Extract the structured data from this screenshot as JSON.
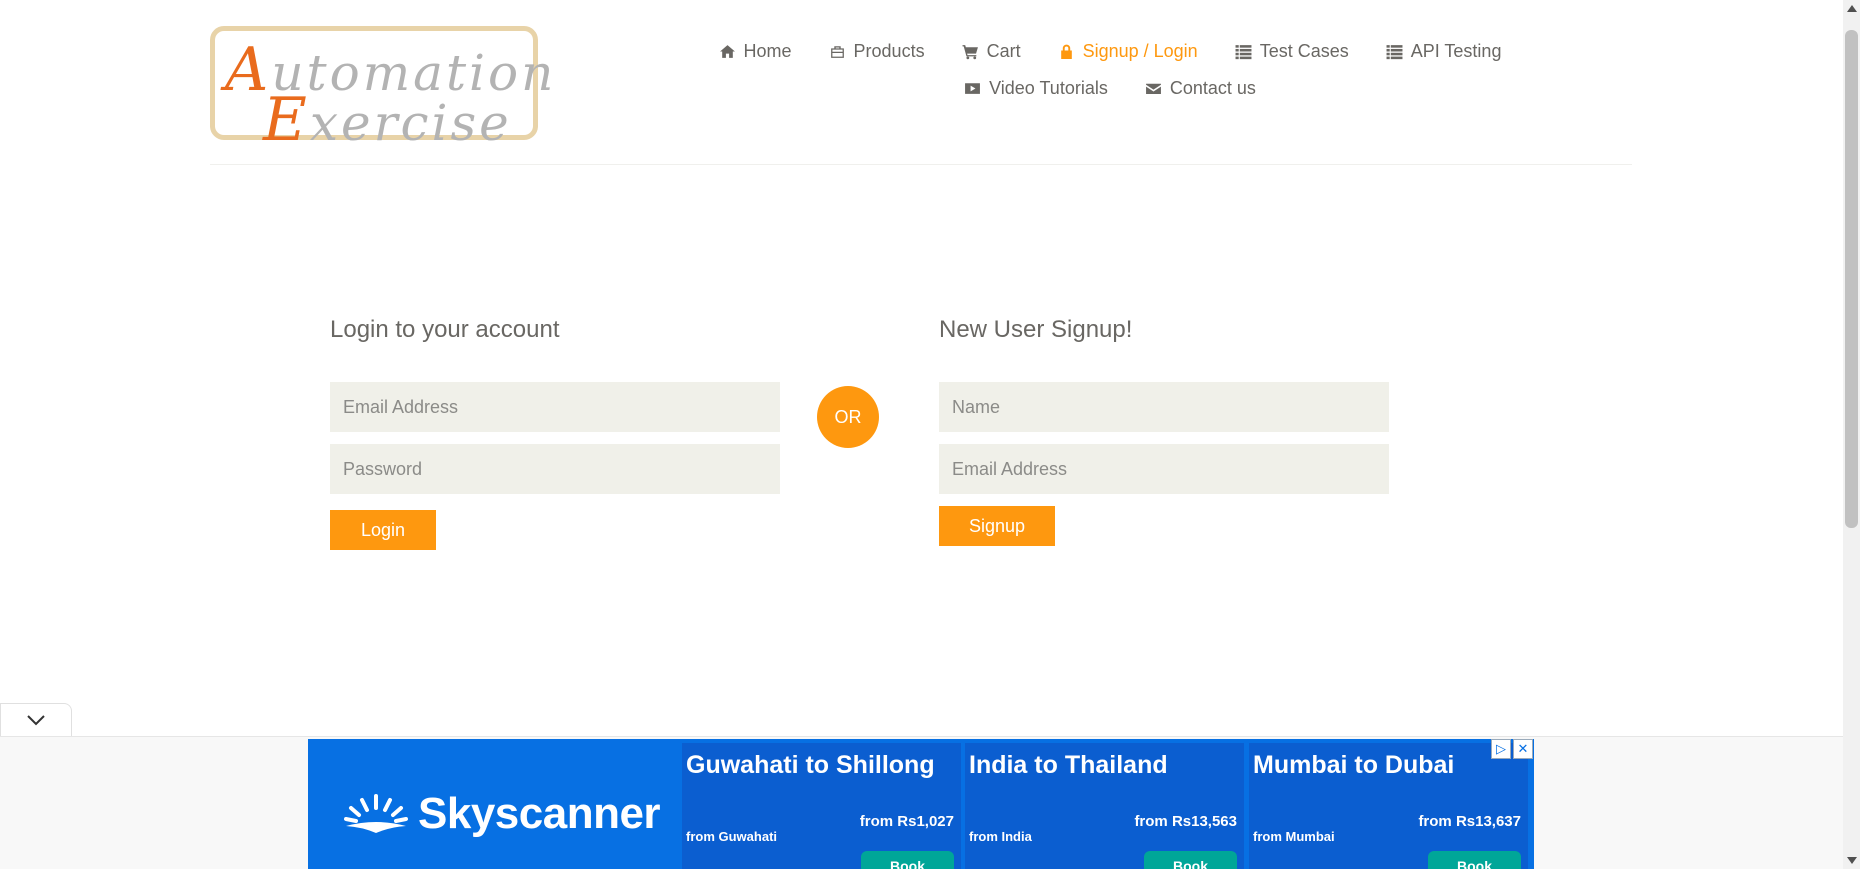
{
  "logo": {
    "line1_cap": "A",
    "line1_rest": "utomation",
    "line2_cap": "E",
    "line2_rest": "xercise"
  },
  "nav": {
    "row1": [
      {
        "label": "Home",
        "icon": "home-icon"
      },
      {
        "label": "Products",
        "icon": "briefcase-icon"
      },
      {
        "label": "Cart",
        "icon": "cart-icon"
      },
      {
        "label": "Signup / Login",
        "icon": "lock-icon",
        "active": true
      },
      {
        "label": "Test Cases",
        "icon": "list-icon"
      },
      {
        "label": "API Testing",
        "icon": "list-icon"
      }
    ],
    "row2": [
      {
        "label": "Video Tutorials",
        "icon": "youtube-play-icon"
      },
      {
        "label": "Contact us",
        "icon": "envelope-icon"
      }
    ]
  },
  "login": {
    "heading": "Login to your account",
    "email_placeholder": "Email Address",
    "password_placeholder": "Password",
    "button": "Login"
  },
  "or_label": "OR",
  "signup": {
    "heading": "New User Signup!",
    "name_placeholder": "Name",
    "email_placeholder": "Email Address",
    "button": "Signup"
  },
  "ad": {
    "brand": "Skyscanner",
    "routes": [
      {
        "title": "Guwahati to Shillong",
        "from": "from Guwahati",
        "price": "from Rs1,027",
        "button": "Book"
      },
      {
        "title": "India to Thailand",
        "from": "from India",
        "price": "from Rs13,563",
        "button": "Book"
      },
      {
        "title": "Mumbai to Dubai",
        "from": "from Mumbai",
        "price": "from Rs13,637",
        "button": "Book"
      }
    ]
  },
  "colors": {
    "accent": "#fe980f",
    "text": "#696763",
    "field_bg": "#f0f0e9",
    "ad_blue": "#0770e3",
    "book_green": "#00a698"
  }
}
